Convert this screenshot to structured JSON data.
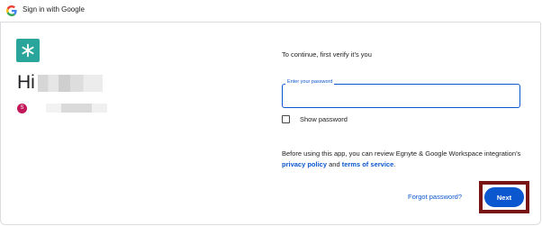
{
  "header": {
    "title": "Sign in with Google",
    "logo_icon": "google-g-icon"
  },
  "account": {
    "app_logo_icon": "asterisk-logo-icon",
    "app_logo_color": "#2aa59b",
    "greeting": "Hi",
    "avatar_initial": "S",
    "avatar_color": "#c2185b"
  },
  "main": {
    "verify_text": "To continue, first verify it’s you",
    "password_label": "Enter your password",
    "show_password_label": "Show password",
    "policy_prefix": "Before using this app, you can review Egnyte & Google Workspace integration’s ",
    "privacy_policy_link": "privacy policy",
    "and_text": " and ",
    "terms_link": "terms of service",
    "period": ".",
    "forgot_password": "Forgot password?",
    "next_button": "Next"
  },
  "colors": {
    "accent": "#0b57d0",
    "highlight": "#7a1414"
  }
}
